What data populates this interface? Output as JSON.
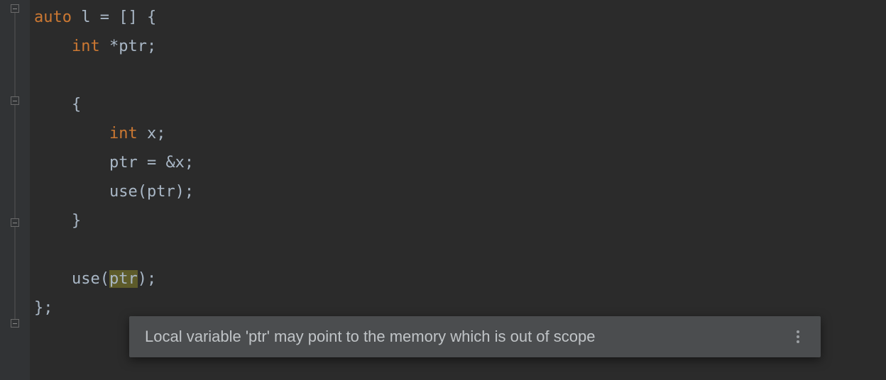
{
  "code": {
    "line1": {
      "kw": "auto",
      "rest": " l = [] {"
    },
    "line2": {
      "indent": "    ",
      "kw": "int",
      "rest": " *ptr;"
    },
    "line3": {
      "text": ""
    },
    "line4": {
      "indent": "    ",
      "text": "{"
    },
    "line5": {
      "indent": "        ",
      "kw": "int",
      "rest": " x;"
    },
    "line6": {
      "indent": "        ",
      "text": "ptr = &x;"
    },
    "line7": {
      "indent": "        ",
      "text": "use(ptr);"
    },
    "line8": {
      "indent": "    ",
      "text": "}"
    },
    "line9": {
      "text": ""
    },
    "line10_prefix": "    use(",
    "line10_hl": "ptr",
    "line10_suffix": ");",
    "line11": {
      "text": "};"
    }
  },
  "tooltip": {
    "message": "Local variable 'ptr' may point to the memory which is out of scope"
  }
}
